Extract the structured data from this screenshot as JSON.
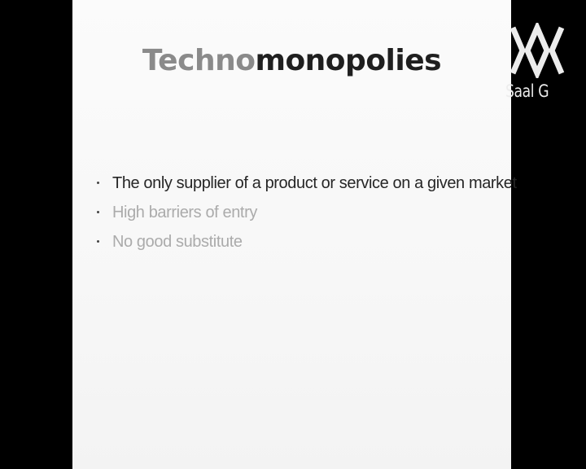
{
  "slide": {
    "title_part1": "Techno",
    "title_part2": "monopolies",
    "bullets": [
      {
        "text": "The only supplier of a product or service on a given market"
      },
      {
        "text": "High barriers of entry"
      },
      {
        "text": "No good substitute"
      }
    ]
  },
  "overlay": {
    "logo_icon": "channel-logo-icon",
    "logo_text": "Saal G"
  },
  "colors": {
    "background": "#000000",
    "slide_bg": "#f7f7f7",
    "title_light": "#8a8a8a",
    "title_dark": "#1f1f1f",
    "bullet_active": "#262626",
    "bullet_dim": "#ababab",
    "logo": "#ededed"
  }
}
